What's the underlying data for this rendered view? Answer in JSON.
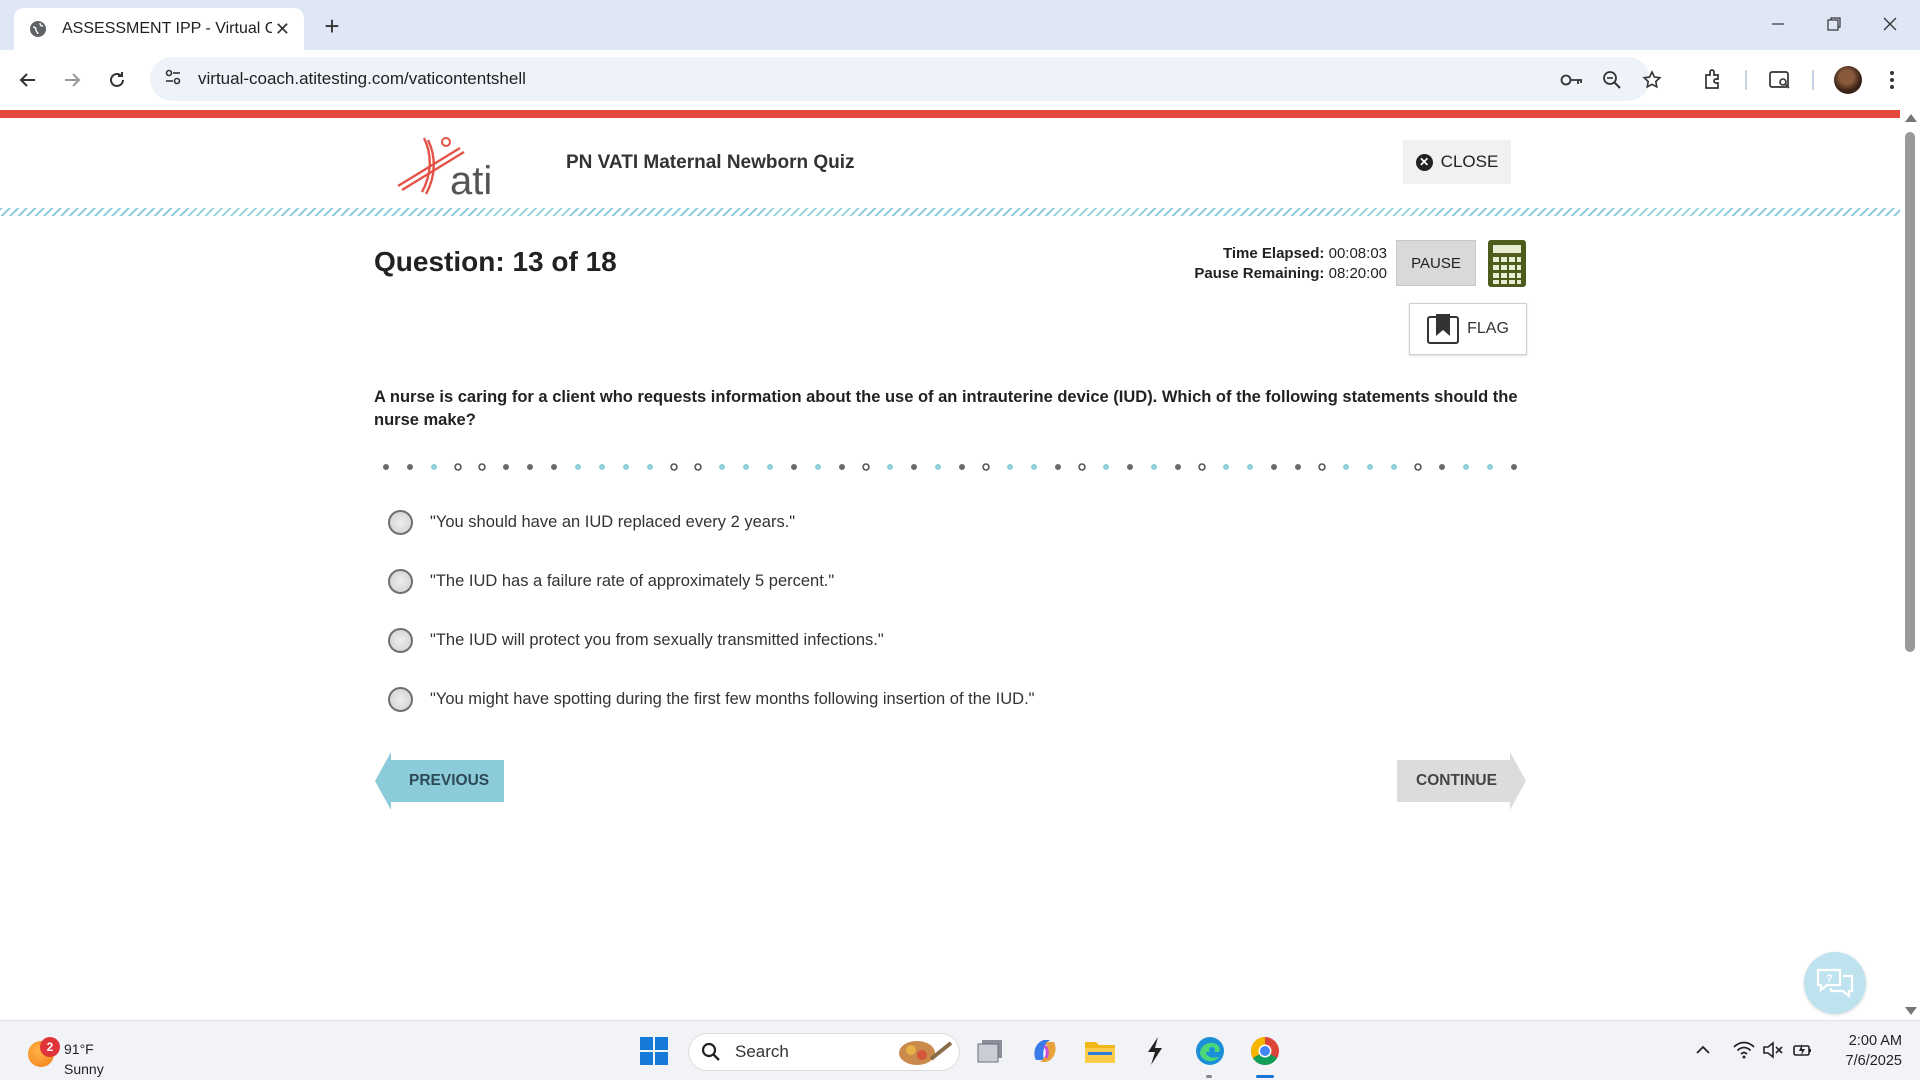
{
  "browser": {
    "tab_title": "ASSESSMENT IPP - Virtual Coac",
    "url": "virtual-coach.atitesting.com/vaticontentshell"
  },
  "header": {
    "logo_text": "ati",
    "quiz_title": "PN VATI Maternal Newborn Quiz",
    "close_label": "CLOSE"
  },
  "question": {
    "number_label": "Question: 13 of 18",
    "time_elapsed_label": "Time Elapsed:",
    "time_elapsed": "00:08:03",
    "pause_remaining_label": "Pause Remaining:",
    "pause_remaining": "08:20:00",
    "pause_label": "PAUSE",
    "flag_label": "FLAG",
    "stem": "A nurse is caring for a client who requests information about the use of an intrauterine device (IUD). Which of the following statements should the nurse make?",
    "options": [
      "\"You should have an IUD replaced every 2 years.\"",
      "\"The IUD has a failure rate of approximately 5 percent.\"",
      "\"The IUD will protect you from sexually transmitted infections.\"",
      "\"You might have spotting during the first few months following insertion of the IUD.\""
    ]
  },
  "navigation": {
    "previous_label": "PREVIOUS",
    "continue_label": "CONTINUE"
  },
  "taskbar": {
    "weather_badge": "2",
    "temperature": "91°F",
    "condition": "Sunny",
    "search_placeholder": "Search",
    "time": "2:00 AM",
    "date": "7/6/2025"
  },
  "colors": {
    "red_bar": "#e5473d",
    "teal": "#8fcfdc",
    "previous_button": "#8ccbd9",
    "continue_button": "#dcdcdc",
    "calculator": "#4d5b1b"
  }
}
